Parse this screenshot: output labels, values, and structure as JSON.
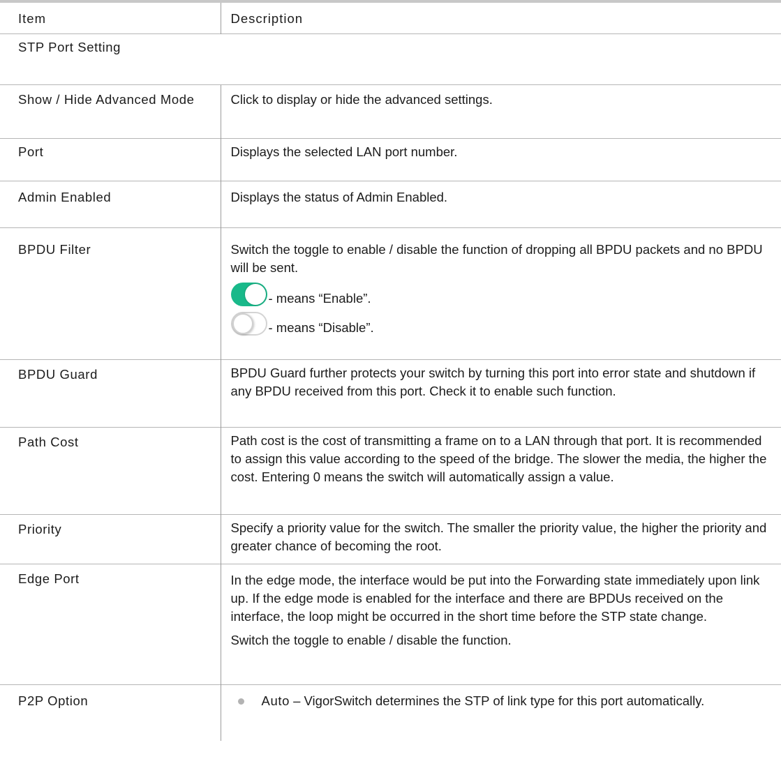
{
  "header": {
    "item": "Item",
    "description": "Description"
  },
  "section_title": "STP Port Setting",
  "rows": [
    {
      "item": "Show / Hide Advanced Mode",
      "desc": "Click to display or hide the advanced settings."
    },
    {
      "item": "Port",
      "desc": "Displays the selected LAN port number."
    },
    {
      "item": "Admin Enabled",
      "desc": "Displays the status of Admin Enabled."
    },
    {
      "item": "BPDU Filter",
      "desc": "Switch the toggle to enable / disable the function of dropping all BPDU packets and no BPDU will be sent.",
      "toggle_on_text": "- means “Enable”.",
      "toggle_off_text": "- means “Disable”."
    },
    {
      "item": "BPDU Guard",
      "desc": "BPDU Guard further protects your switch by turning this port into error state and shutdown if any BPDU received from this port. Check it to enable such function."
    },
    {
      "item": "Path Cost",
      "desc": "Path cost is the cost of transmitting a frame on to a LAN through that port. It is recommended to assign this value according to the speed of the bridge. The slower the media, the higher the cost. Entering 0 means the switch will automatically assign a value."
    },
    {
      "item": "Priority",
      "desc": "Specify a priority value for the switch. The smaller the priority value, the higher the priority and greater chance of becoming the root."
    },
    {
      "item": "Edge Port",
      "desc": "In the edge mode, the interface would be put into the Forwarding state immediately upon link up. If the edge mode is enabled for the interface and there are BPDUs received on the interface, the loop might be occurred in the short time before the STP state change.",
      "desc2": "Switch the toggle to enable / disable the function."
    },
    {
      "item": "P2P Option",
      "bullets": [
        {
          "name": "Auto",
          "text": " – VigorSwitch determines the STP of link type for this port automatically."
        }
      ]
    }
  ],
  "colors": {
    "toggle_on": "#19b98a",
    "border": "#9b9b9b",
    "bullet": "#b3b3b3"
  }
}
